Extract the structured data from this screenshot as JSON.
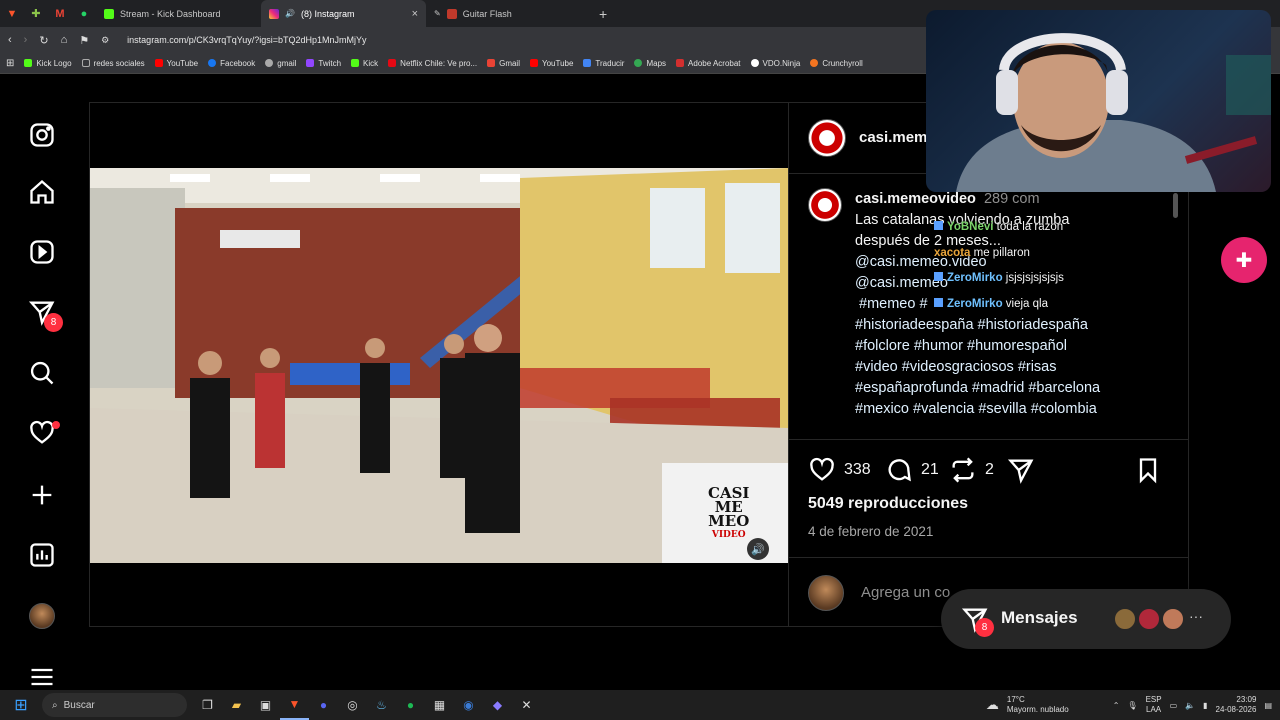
{
  "browser": {
    "tabs": [
      {
        "label": "Stream - Kick Dashboard",
        "active": false
      },
      {
        "label": "(8) Instagram",
        "active": true
      },
      {
        "label": "Guitar Flash",
        "active": false
      }
    ],
    "url": "instagram.com/p/CK3vrqTqYuy/?igsi=bTQ2dHp1MnJmMjYy",
    "bookmarks": [
      "Kick Logo",
      "redes sociales",
      "YouTube",
      "Facebook",
      "gmail",
      "Twitch",
      "Kick",
      "Netflix Chile: Ve pro...",
      "Gmail",
      "YouTube",
      "Traducir",
      "Maps",
      "Adobe Acrobat",
      "VDO.Ninja",
      "Crunchyroll"
    ]
  },
  "sidebar": {
    "reels_badge": "8"
  },
  "post": {
    "header_username": "casi.mem",
    "caption_username": "casi.memeovideo",
    "caption_username_suffix": "289 com",
    "caption_lines": [
      "Las catalanas volviendo a zumba",
      "después de 2 meses..."
    ],
    "mentions": [
      "@casi.memeo.video",
      "@casi.memeo"
    ],
    "hashtag_lines": [
      "#memeo #",
      "#historiadeespaña #historiadespaña",
      "#folclore #humor #humorespañol",
      "#video #videosgraciosos #risas",
      "#españaprofunda #madrid #barcelona",
      "#mexico #valencia #sevilla #colombia"
    ],
    "likes": "338",
    "comments": "21",
    "shares": "2",
    "plays": "5049 reproducciones",
    "date": "4 de febrero de 2021",
    "comment_placeholder": "Agrega un co",
    "video_logo": [
      "CASI",
      "ME",
      "MEO",
      "VIDEO"
    ]
  },
  "chat_overlay": [
    {
      "user": "YoBNevi",
      "text": "toda la razon",
      "color": "#7bd36a"
    },
    {
      "user": "xacota",
      "text": "me pillaron",
      "color": "#e9a53a"
    },
    {
      "user": "ZeroMirko",
      "text": "jsjsjsjsjsjsjs",
      "color": "#6fc1ff"
    },
    {
      "user": "ZeroMirko",
      "text": "vieja qla",
      "color": "#6fc1ff"
    }
  ],
  "messages": {
    "label": "Mensajes",
    "badge": "8"
  },
  "taskbar": {
    "search_placeholder": "Buscar",
    "weather_temp": "17°C",
    "weather_desc": "Mayorm. nublado",
    "lang_line1": "ESP",
    "lang_line2": "LAA",
    "time": "23:09",
    "date": "24-08-2026"
  }
}
